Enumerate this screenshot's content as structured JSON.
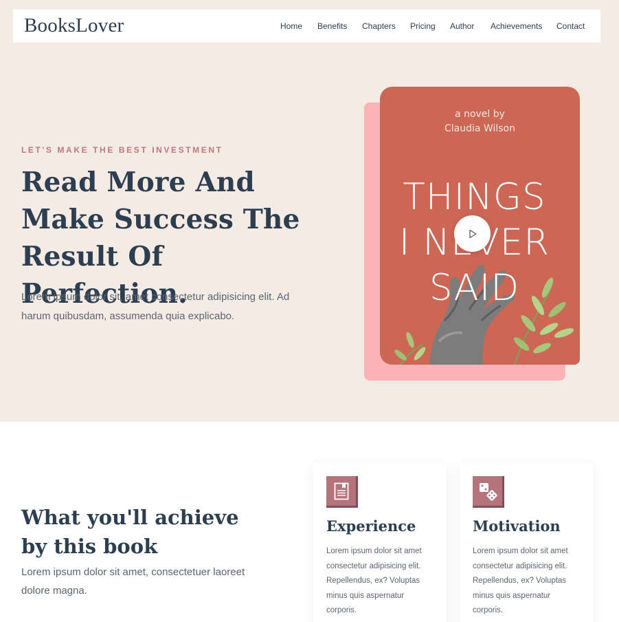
{
  "brand": "BooksLover",
  "nav": {
    "items": [
      {
        "label": "Home"
      },
      {
        "label": "Benefits"
      },
      {
        "label": "Chapters"
      },
      {
        "label": "Pricing"
      },
      {
        "label": "Author"
      },
      {
        "label": "Achievements"
      },
      {
        "label": "Contact"
      }
    ]
  },
  "hero": {
    "kicker": "LET'S MAKE THE BEST INVESTMENT",
    "title": "Read More And Make Success The Result Of Perfection.",
    "text": "Lorem ipsum dolor sit, amet consectetur adipisicing elit. Ad harum quibusdam, assumenda quia explicabo.",
    "cover": {
      "byline_1": "a novel by",
      "byline_2": "Claudia Wilson",
      "title_line_1": "THINGS",
      "title_line_2": "I NEVER",
      "title_line_3": "SAID"
    },
    "play_icon": "play-icon"
  },
  "achieve": {
    "title_line_1": "What you'll achieve",
    "title_line_2": "by this book",
    "text": "Lorem ipsum dolor sit amet, consectetuer laoreet dolore magna.",
    "cards": [
      {
        "icon": "book-icon",
        "title": "Experience",
        "text": "Lorem ipsum dolor sit amet consectetur adipisicing elit. Repellendus, ex? Voluptas minus quis aspernatur corporis."
      },
      {
        "icon": "dice-icon",
        "title": "Motivation",
        "text": "Lorem ipsum dolor sit amet consectetur adipisicing elit. Repellendus, ex? Voluptas minus quis aspernatur corporis."
      }
    ]
  },
  "colors": {
    "hero_bg": "#f4ebe5",
    "accent": "#c27779",
    "cover": "#cc6756",
    "cover_shadow": "#fbb3b5",
    "heading": "#2c3e50",
    "icon_bg": "#b5737b"
  }
}
